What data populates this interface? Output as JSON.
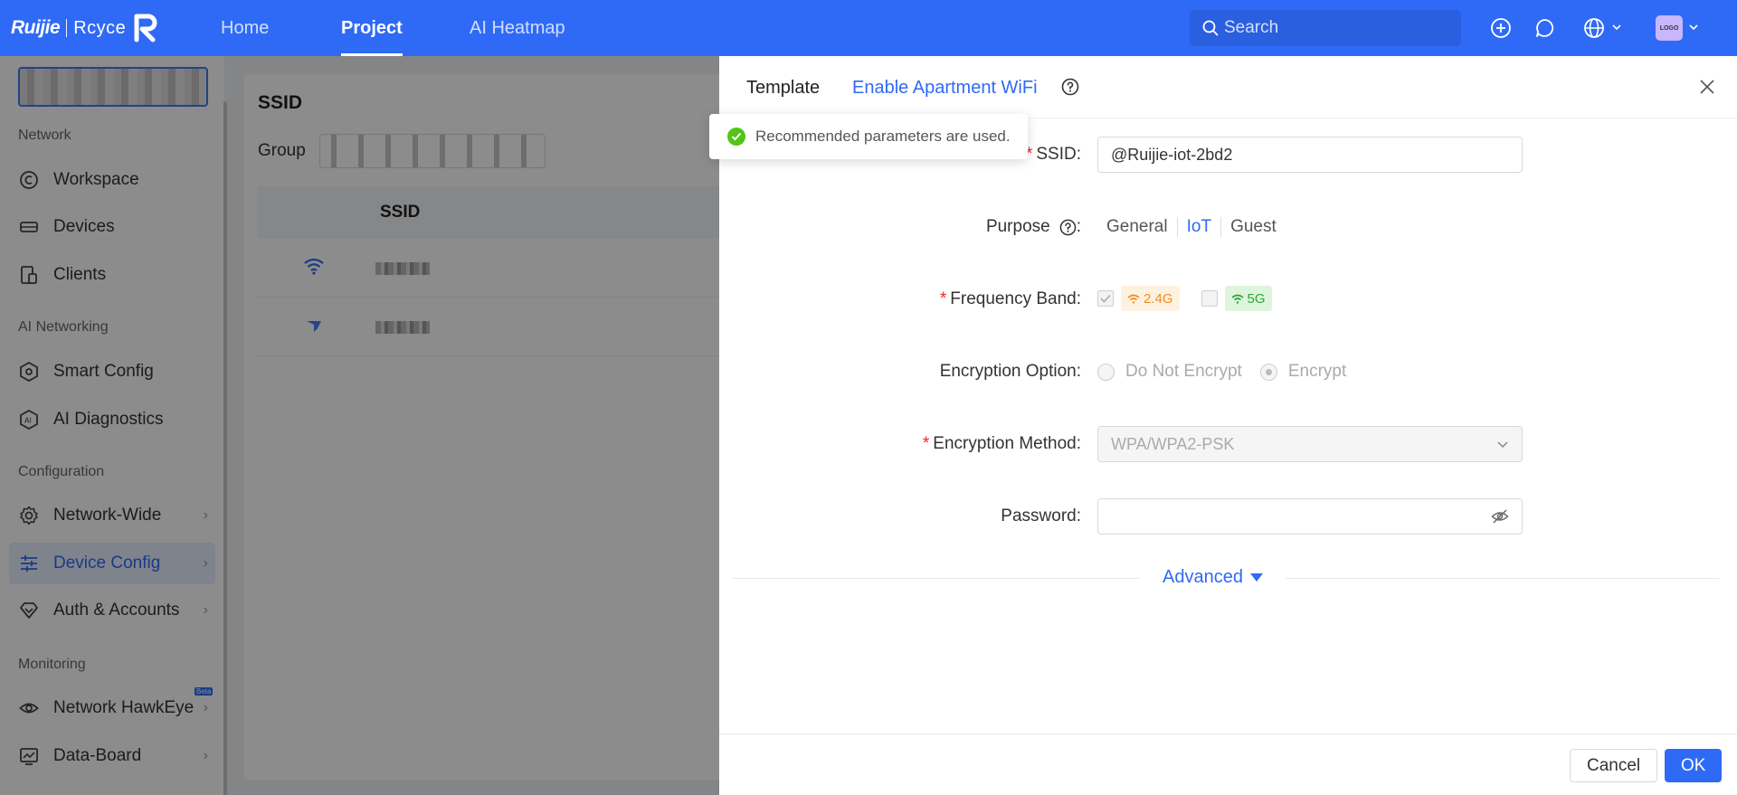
{
  "brand": {
    "name": "Ruijie",
    "product": "Rcyce"
  },
  "nav": {
    "tabs": [
      {
        "label": "Home",
        "active": false
      },
      {
        "label": "Project",
        "active": true
      },
      {
        "label": "AI Heatmap",
        "active": false
      }
    ]
  },
  "search": {
    "placeholder": "Search"
  },
  "user": {
    "avatar_text": "LOGO"
  },
  "sidebar": {
    "sections": {
      "network": "Network",
      "ai_networking": "AI Networking",
      "configuration": "Configuration",
      "monitoring": "Monitoring"
    },
    "items": {
      "workspace": "Workspace",
      "devices": "Devices",
      "clients": "Clients",
      "smart_config": "Smart Config",
      "ai_diagnostics": "AI Diagnostics",
      "network_wide": "Network-Wide",
      "device_config": "Device Config",
      "auth_accounts": "Auth & Accounts",
      "network_hawkeye": "Network HawkEye",
      "data_board": "Data-Board"
    },
    "beta_badge": "Beta"
  },
  "main": {
    "title": "SSID",
    "group_label": "Group",
    "table": {
      "columns": [
        "SSID"
      ]
    }
  },
  "drawer": {
    "tab_template": "Template",
    "tab_apartment": "Enable Apartment WiFi",
    "form": {
      "ssid_label": "SSID:",
      "ssid_value": "@Ruijie-iot-2bd2",
      "purpose_label": "Purpose",
      "purpose_colon": ":",
      "purpose_options": [
        "General",
        "IoT",
        "Guest"
      ],
      "purpose_selected": "IoT",
      "band_label": "Frequency Band:",
      "band_24": "2.4G",
      "band_5": "5G",
      "encryption_option_label": "Encryption Option:",
      "encryption_no": "Do Not Encrypt",
      "encryption_yes": "Encrypt",
      "encryption_method_label": "Encryption Method:",
      "encryption_method_value": "WPA/WPA2-PSK",
      "password_label": "Password:",
      "password_value": ""
    },
    "advanced_label": "Advanced",
    "cancel_label": "Cancel",
    "ok_label": "OK"
  },
  "toast": {
    "message": "Recommended parameters are used."
  },
  "colors": {
    "primary": "#2f6af6",
    "success": "#52c41a",
    "required": "#f5222d",
    "band_24": "#f18b1f",
    "band_5": "#2fa33a"
  }
}
